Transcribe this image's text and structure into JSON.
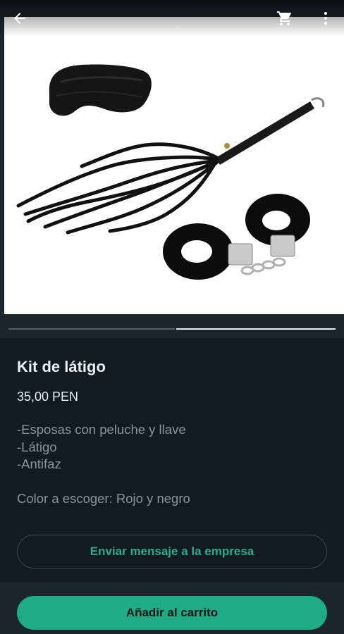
{
  "product": {
    "title": "Kit de látigo",
    "price": "35,00 PEN",
    "description_lines": [
      "-Esposas con peluche y llave",
      "-Látigo",
      "-Antifaz"
    ],
    "color_note": "Color a escoger: Rojo y negro"
  },
  "gallery": {
    "image_count": 2,
    "active_index": 2
  },
  "actions": {
    "message_label": "Enviar mensaje a la empresa",
    "add_to_cart_label": "Añadir al carrito"
  },
  "icons": {
    "back": "arrow-left-icon",
    "cart": "shopping-cart-icon",
    "more": "more-vert-icon"
  },
  "colors": {
    "background": "#121b22",
    "accent": "#1fac84",
    "accent_text": "#25b08a",
    "primary_text": "#e9edef",
    "secondary_text": "#8696a0"
  }
}
